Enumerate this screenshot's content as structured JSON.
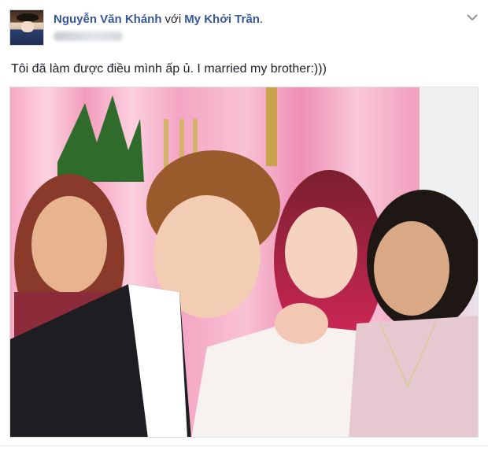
{
  "post": {
    "author": "Nguyễn Văn Khánh",
    "with_text": "với",
    "tagged_user": "My Khởi Trần",
    "period": ".",
    "text": "Tôi đã làm được điều mình ấp ủ. I married my brother:)))",
    "icons": {
      "options": "chevron-down-icon"
    },
    "colors": {
      "name_link": "#365899",
      "body_text": "#1d2129"
    }
  }
}
